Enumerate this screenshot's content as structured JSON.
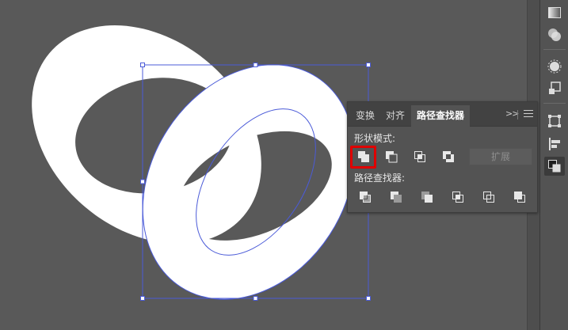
{
  "pathfinder_panel": {
    "tabs": [
      {
        "label": "变换",
        "active": false
      },
      {
        "label": "对齐",
        "active": false
      },
      {
        "label": "路径查找器",
        "active": true
      }
    ],
    "collapse_label": ">>",
    "shape_modes_label": "形状模式:",
    "shape_mode_buttons": [
      "unite-icon",
      "minus-front-icon",
      "intersect-icon",
      "exclude-icon"
    ],
    "expand_label": "扩展",
    "pathfinders_label": "路径查找器:",
    "pathfinder_buttons": [
      "divide-icon",
      "trim-icon",
      "merge-icon",
      "crop-icon",
      "outline-icon",
      "minus-back-icon"
    ],
    "highlighted_button": "unite-icon"
  },
  "right_toolbar": {
    "tools": [
      "gradient-icon",
      "transparency-icon",
      "appearance-icon",
      "symbols-icon",
      "transform-icon",
      "align-icon",
      "pathfinder-icon"
    ],
    "active_tool": "pathfinder-icon"
  },
  "canvas": {
    "background_color": "#595959",
    "shape_fill": "#ffffff",
    "selection_color": "#4b5bd8"
  }
}
